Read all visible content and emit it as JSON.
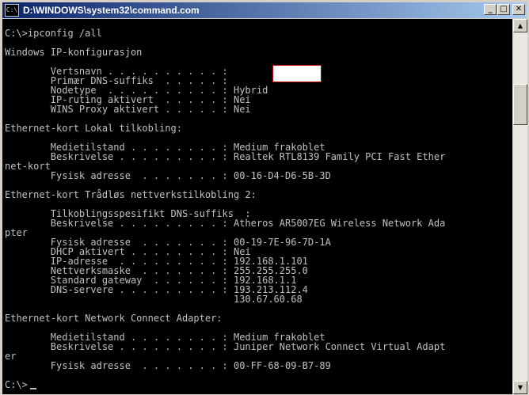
{
  "window": {
    "title": "D:\\WINDOWS\\system32\\command.com",
    "icon_label": "C:\\",
    "buttons": {
      "minimize": "_",
      "maximize": "□",
      "close": "✕"
    }
  },
  "console": {
    "text": "C:\\>ipconfig /all\n\nWindows IP-konfigurasjon\n\n        Vertsnavn . . . . . . . . . . :\n        Primær DNS-suffiks  . . . . . :\n        Nodetype  . . . . . . . . . . : Hybrid\n        IP-ruting aktivert  . . . . . : Nei\n        WINS Proxy aktivert . . . . . : Nei\n\nEthernet-kort Lokal tilkobling:\n\n        Medietilstand . . . . . . . . : Medium frakoblet\n        Beskrivelse . . . . . . . . . : Realtek RTL8139 Family PCI Fast Ether\nnet-kort\n        Fysisk adresse  . . . . . . . : 00-16-D4-D6-5B-3D\n\nEthernet-kort Trådløs nettverkstilkobling 2:\n\n        Tilkoblingsspesifikt DNS-suffiks  :\n        Beskrivelse . . . . . . . . . : Atheros AR5007EG Wireless Network Ada\npter\n        Fysisk adresse  . . . . . . . : 00-19-7E-96-7D-1A\n        DHCP aktivert . . . . . . . . : Nei\n        IP-adresse  . . . . . . . . . : 192.168.1.101\n        Nettverksmaske  . . . . . . . : 255.255.255.0\n        Standard gateway  . . . . . . : 192.168.1.1\n        DNS-servere . . . . . . . . . : 193.213.112.4\n                                        130.67.60.68\n\nEthernet-kort Network Connect Adapter:\n\n        Medietilstand . . . . . . . . : Medium frakoblet\n        Beskrivelse . . . . . . . . . : Juniper Network Connect Virtual Adapt\ner\n        Fysisk adresse  . . . . . . . : 00-FF-68-09-B7-89\n\nC:\\>",
    "text_color": "#c0c0c0",
    "background": "#000000"
  },
  "scrollbar": {
    "up_icon": "▲",
    "down_icon": "▼"
  }
}
